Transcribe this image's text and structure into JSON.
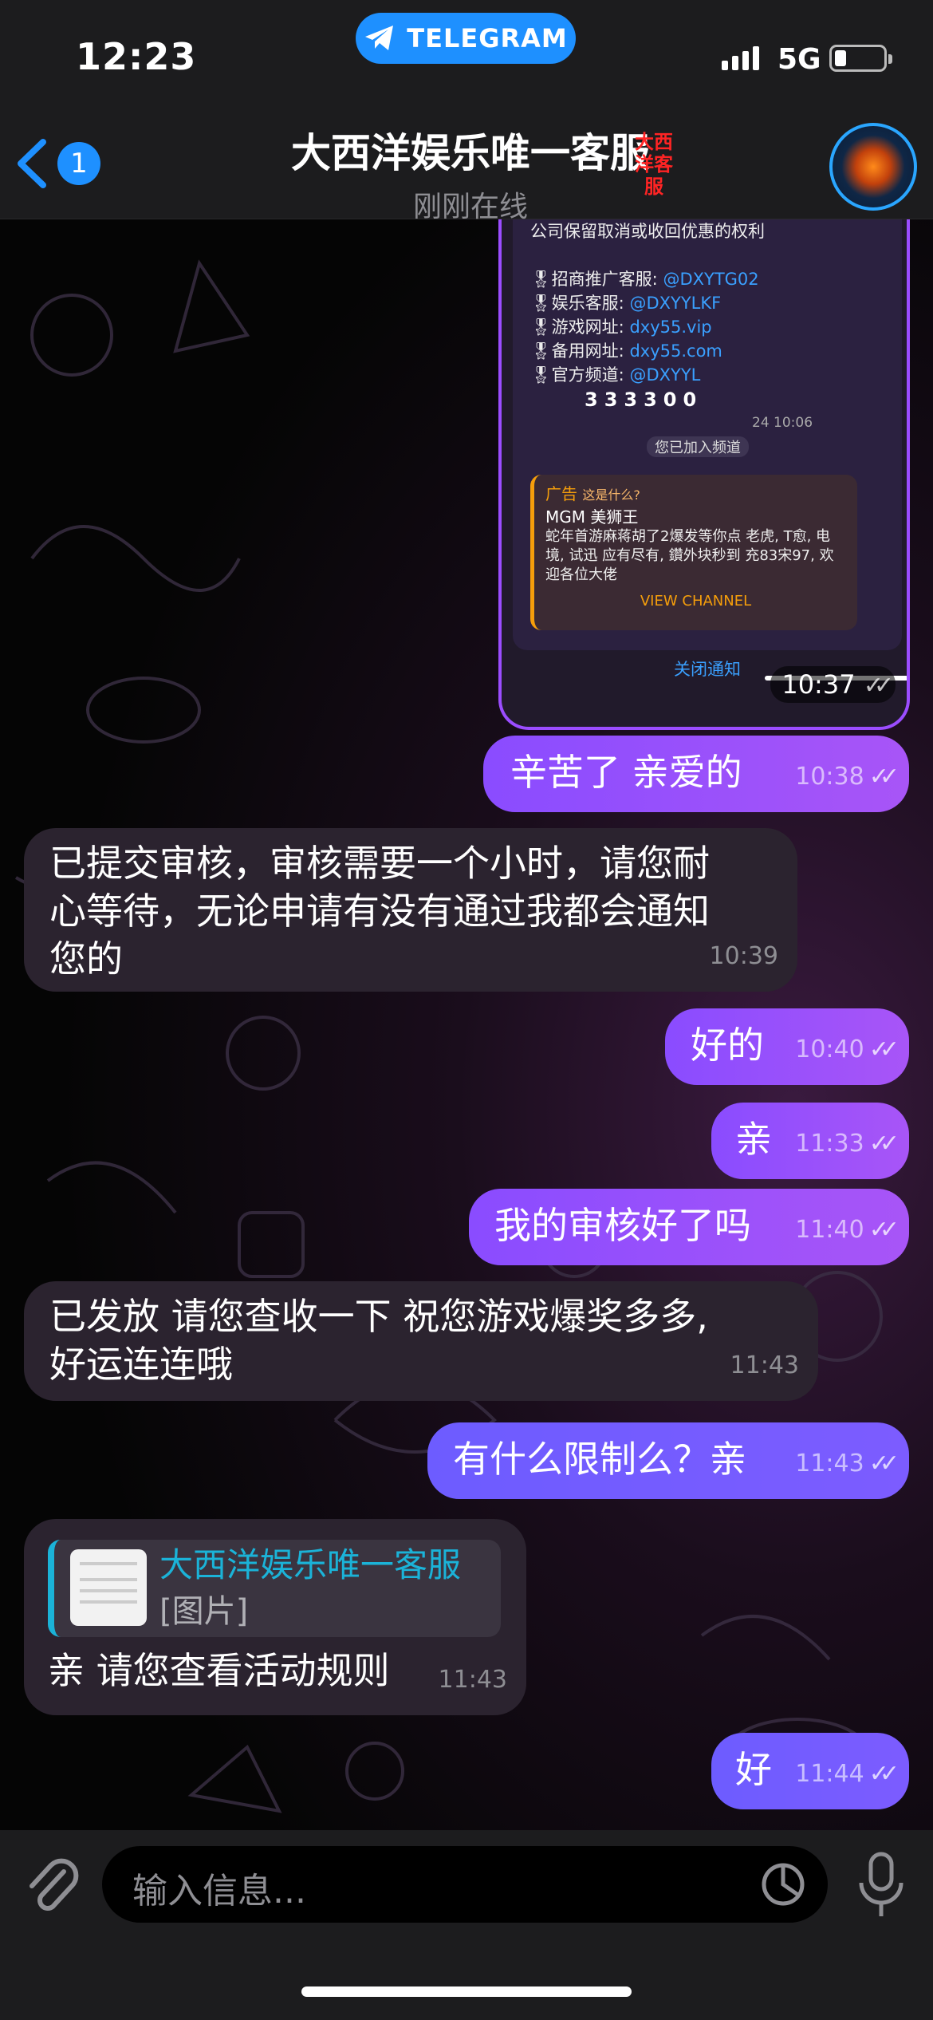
{
  "status_bar": {
    "time": "12:23",
    "telegram_label": "TELEGRAM",
    "network": "5G"
  },
  "header": {
    "back_count": "1",
    "title": "大西洋娱乐唯一客服",
    "title_badge": "大西洋客服",
    "status": "刚刚在线"
  },
  "screenshot": {
    "line1": "公司保留取消或收回优惠的权利",
    "rows": [
      {
        "label": "招商推广客服:",
        "value": "@DXYTG02"
      },
      {
        "label": "娱乐客服:",
        "value": "@DXYYLKF"
      },
      {
        "label": "游戏网址:",
        "value": "dxy55.vip"
      },
      {
        "label": "备用网址:",
        "value": "dxy55.com"
      },
      {
        "label": "官方频道:",
        "value": "@DXYYL"
      }
    ],
    "digits": "333300",
    "views": "24 10:06",
    "joined": "您已加入频道",
    "ad_tag": "广告",
    "ad_why": "这是什么?",
    "ad_title": "MGM 美狮王",
    "ad_body": "蛇年首游麻蒋胡了2爆发等你点 老虎, T愈, 电境, 试迅 应有尽有, 鑽外块秒到 充83宋97, 欢迎各位大佬",
    "ad_button": "VIEW CHANNEL",
    "close_notice": "关闭通知",
    "time": "10:37"
  },
  "messages": [
    {
      "dir": "out",
      "text": "辛苦了 亲爱的",
      "time": "10:38"
    },
    {
      "dir": "in",
      "text": "已提交审核，审核需要一个小时，请您耐心等待，无论申请有没有通过我都会通知您的",
      "line1": "已提交审核，审核需要一个小时，请您耐",
      "line2": "心等待，无论申请有没有通过我都会通知",
      "line3": "您的",
      "time": "10:39"
    },
    {
      "dir": "out",
      "text": "好的",
      "time": "10:40"
    },
    {
      "dir": "out",
      "text": "亲",
      "time": "11:33"
    },
    {
      "dir": "out",
      "text": "我的审核好了吗",
      "time": "11:40"
    },
    {
      "dir": "in",
      "line1": "已发放 请您查收一下 祝您游戏爆奖多多,",
      "line2": "好运连连哦",
      "time": "11:43"
    },
    {
      "dir": "out",
      "text": "有什么限制么？亲",
      "time": "11:43"
    },
    {
      "dir": "in",
      "reply_name": "大西洋娱乐唯一客服",
      "reply_text": "[图片]",
      "text": "亲 请您查看活动规则",
      "time": "11:43"
    },
    {
      "dir": "out",
      "text": "好",
      "time": "11:44"
    }
  ],
  "input": {
    "placeholder": "输入信息..."
  }
}
